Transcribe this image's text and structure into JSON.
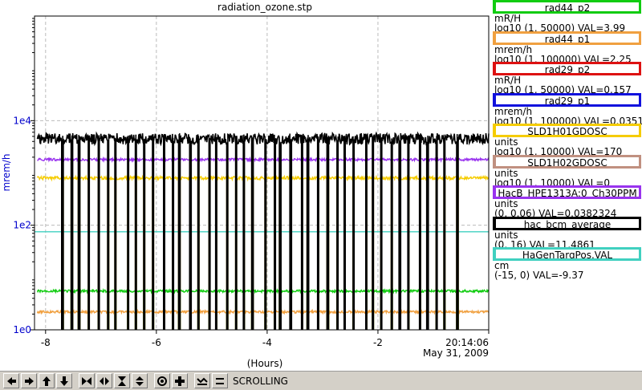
{
  "chart_data": {
    "type": "line",
    "title": "radiation_ozone.stp",
    "xlabel": "(Hours)",
    "ylabel": "mrem/h",
    "x_ticks": [
      "-8",
      "-6",
      "-4",
      "-2"
    ],
    "x_end_time": "20:14:06",
    "x_end_date": "May 31, 2009",
    "y_ticks": [
      "1e4",
      "1e2",
      "1e0"
    ],
    "y_scale": "log",
    "xlim": [
      -8.2,
      0
    ],
    "ylim": [
      1,
      1000000
    ],
    "grid": true,
    "legend_position": "right",
    "series": [
      {
        "name": "rad44_p2",
        "unit": "mR/H",
        "range_text": "log10 (1, 50000) VAL=3.99",
        "color": "#11cc11",
        "level": 5.5,
        "dropouts": true
      },
      {
        "name": "rad44_p1",
        "unit": "mrem/h",
        "range_text": "log10 (1, 100000) VAL=2.25",
        "color": "#f0a040",
        "level": 2.2,
        "dropouts": true
      },
      {
        "name": "rad29_p2",
        "unit": "mR/H",
        "range_text": "log10 (1, 50000) VAL=0.157",
        "color": "#dd1111",
        "level": null,
        "dropouts": false
      },
      {
        "name": "rad29_p1",
        "unit": "mrem/h",
        "range_text": "log10 (1, 100000) VAL=0.0351",
        "color": "#1111dd",
        "level": null,
        "dropouts": false
      },
      {
        "name": "SLD1H01GDOSC",
        "unit": "units",
        "range_text": "log10 (1, 10000) VAL=170",
        "color": "#f5cc00",
        "level": 170,
        "dropouts": true
      },
      {
        "name": "SLD1H02GDOSC",
        "unit": "units",
        "range_text": "log10 (1, 10000) VAL=0",
        "color": "#c09080",
        "level": null,
        "dropouts": false
      },
      {
        "name": "HacB_HPE1313A:0_Ch30PPM",
        "unit": "units",
        "range_text": "(0, 0.06) VAL=0.0382324",
        "color": "#9933ee",
        "level": 0.0382,
        "dropouts": false
      },
      {
        "name": "hac_bcm_average",
        "unit": "units",
        "range_text": "(0, 16) VAL=11.4861",
        "color": "#000000",
        "level": 11.49,
        "dropouts": true
      },
      {
        "name": "HaGenTargPos.VAL",
        "unit": "cm",
        "range_text": "(-15, 0) VAL=-9.37",
        "color": "#40d0c0",
        "level": -9.37,
        "dropouts": false
      }
    ]
  },
  "toolbar": {
    "status": "SCROLLING",
    "buttons": [
      {
        "icon": "arrow-left-icon"
      },
      {
        "icon": "arrow-right-icon"
      },
      {
        "icon": "arrow-up-icon"
      },
      {
        "icon": "arrow-down-icon"
      },
      {
        "icon": "zoom-in-horizontal-icon"
      },
      {
        "icon": "zoom-out-horizontal-icon"
      },
      {
        "icon": "zoom-in-vertical-icon"
      },
      {
        "icon": "zoom-out-vertical-icon"
      },
      {
        "icon": "auto-scale-icon"
      },
      {
        "icon": "crosshair-icon"
      },
      {
        "icon": "scroll-icon"
      },
      {
        "icon": "pause-icon"
      }
    ]
  }
}
